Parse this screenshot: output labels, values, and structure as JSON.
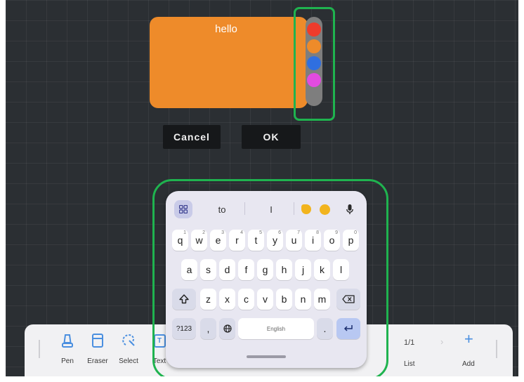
{
  "note": {
    "text": "hello",
    "color": "#ee8b2a"
  },
  "palette": {
    "colors": [
      "#ef3b2c",
      "#ee8b2a",
      "#2f6fe0",
      "#e24be0"
    ]
  },
  "dialog": {
    "cancel_label": "Cancel",
    "ok_label": "OK"
  },
  "toolbar": {
    "tools": [
      {
        "label": "Pen",
        "icon": "pen-icon"
      },
      {
        "label": "Eraser",
        "icon": "eraser-icon"
      },
      {
        "label": "Select",
        "icon": "lasso-select-icon"
      },
      {
        "label": "Text",
        "icon": "text-box-icon"
      }
    ],
    "page_indicator": "1/1",
    "list_label": "List",
    "add_label": "Add"
  },
  "keyboard": {
    "suggestions": [
      "to",
      "I"
    ],
    "row1": [
      "q",
      "w",
      "e",
      "r",
      "t",
      "y",
      "u",
      "i",
      "o",
      "p"
    ],
    "row1_hints": [
      "1",
      "2",
      "3",
      "4",
      "5",
      "6",
      "7",
      "8",
      "9",
      "0"
    ],
    "row2": [
      "a",
      "s",
      "d",
      "f",
      "g",
      "h",
      "j",
      "k",
      "l"
    ],
    "row3": [
      "z",
      "x",
      "c",
      "v",
      "b",
      "n",
      "m"
    ],
    "symbols_key": "?123",
    "comma_key": ",",
    "space_label": "English",
    "period_key": "."
  }
}
